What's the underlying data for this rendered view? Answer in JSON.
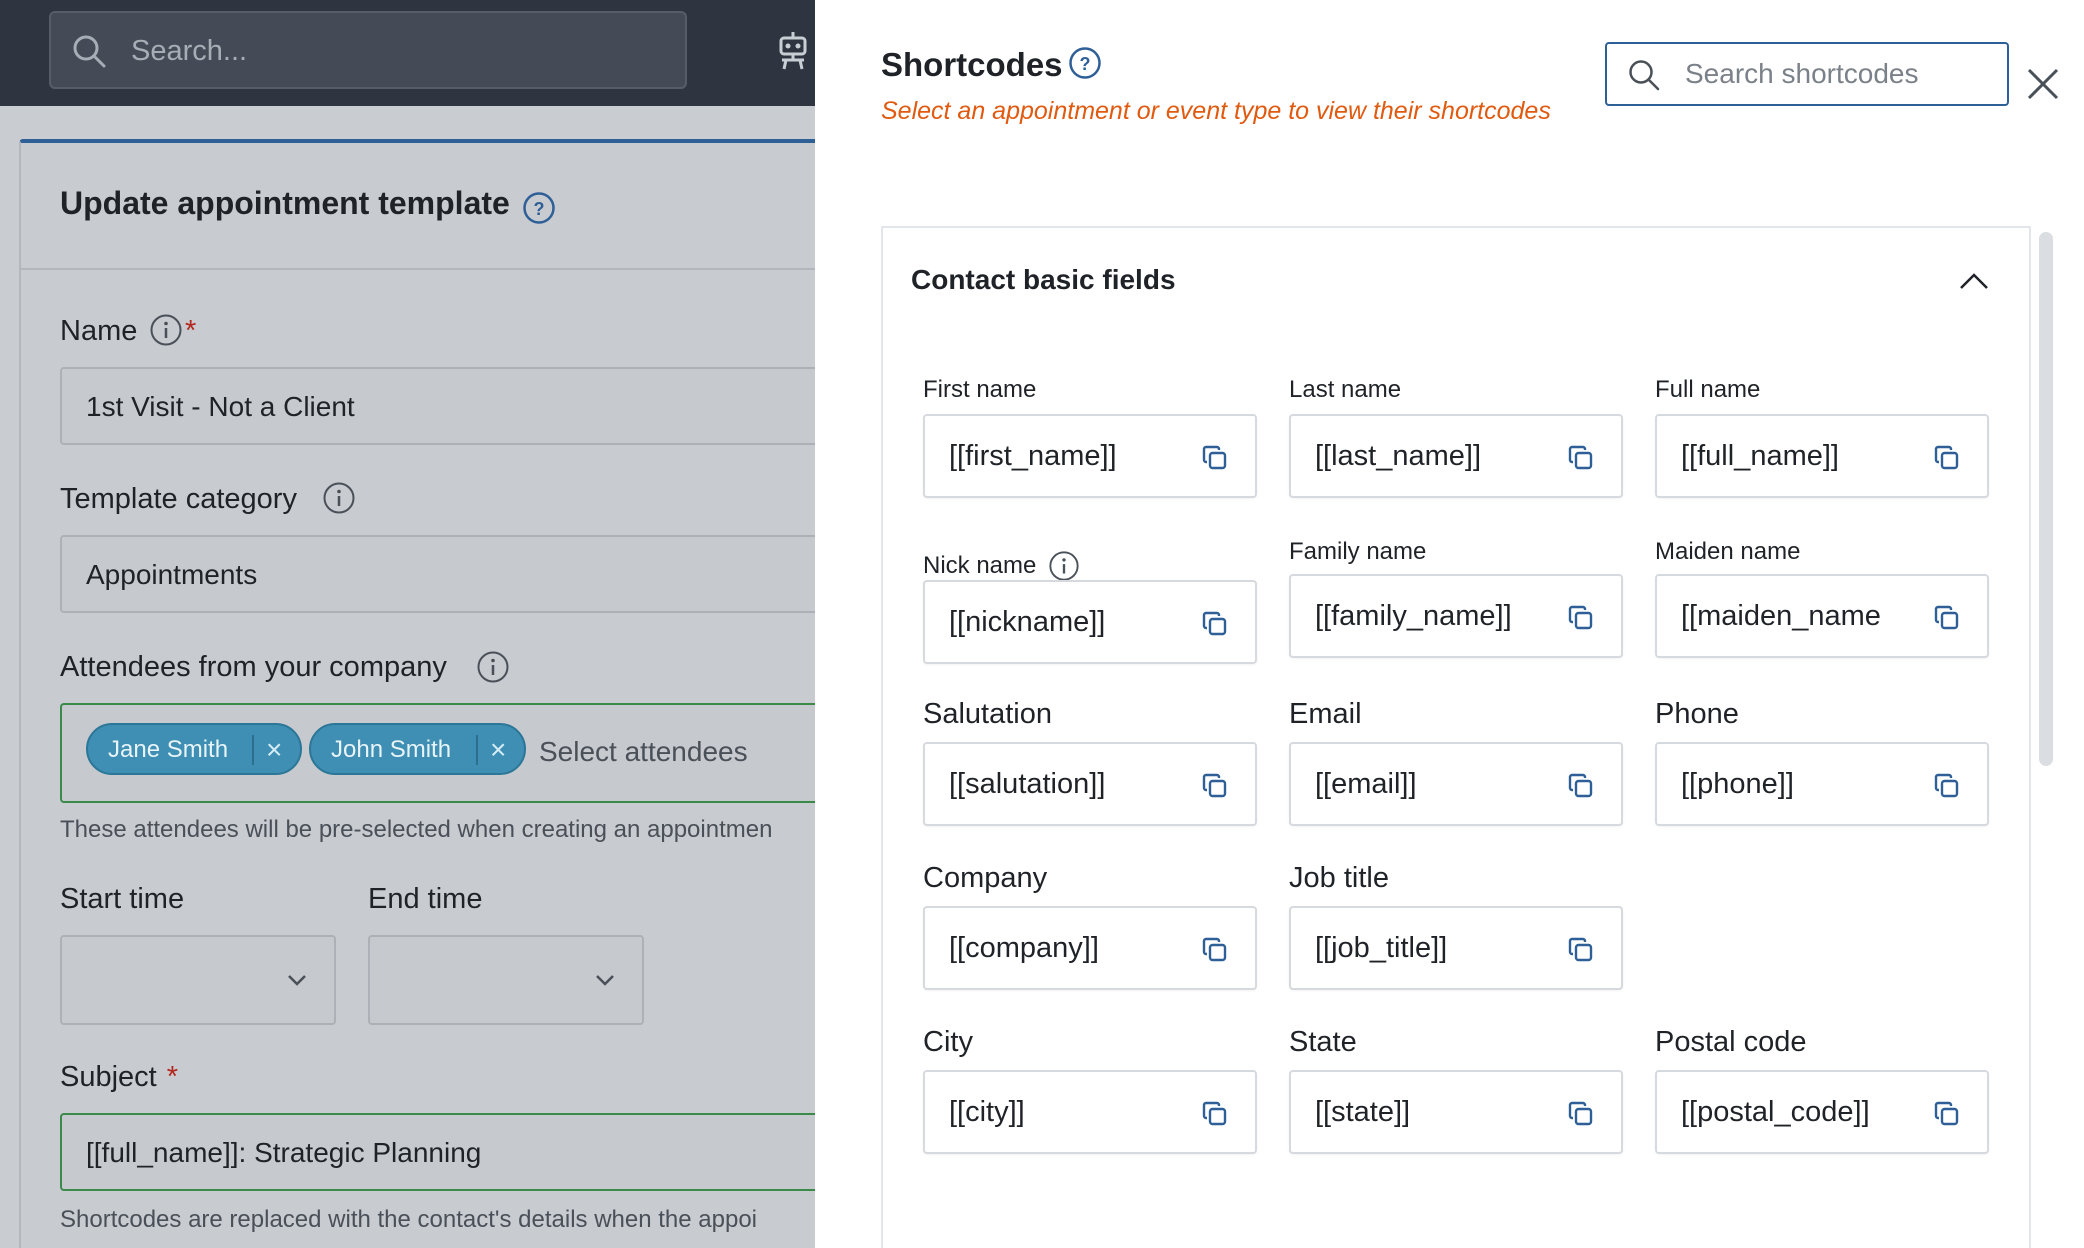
{
  "app_search": {
    "placeholder": "Search..."
  },
  "form": {
    "title": "Update appointment template",
    "name": {
      "label": "Name",
      "required_mark": "*",
      "value": "1st Visit - Not a Client"
    },
    "template_category": {
      "label": "Template category",
      "value": "Appointments"
    },
    "attendees": {
      "label": "Attendees from your company",
      "chips": [
        "Jane Smith",
        "John Smith"
      ],
      "remove_glyph": "×",
      "placeholder": "Select attendees",
      "hint": "These attendees will be pre-selected when creating an appointmen"
    },
    "start_time": {
      "label": "Start time"
    },
    "end_time": {
      "label": "End time"
    },
    "subject": {
      "label": "Subject",
      "required_mark": "*",
      "value": "[[full_name]]: Strategic Planning",
      "hint": "Shortcodes are replaced with the contact's details when the appoi"
    }
  },
  "drawer": {
    "title": "Shortcodes",
    "subtitle": "Select an appointment or event type to view their shortcodes",
    "search_placeholder": "Search shortcodes",
    "section": {
      "title": "Contact basic fields",
      "fields": [
        {
          "label": "First name",
          "code": "[[first_name]]"
        },
        {
          "label": "Last name",
          "code": "[[last_name]]"
        },
        {
          "label": "Full name",
          "code": "[[full_name]]"
        },
        {
          "label": "Nick name",
          "code": "[[nickname]]",
          "info": true
        },
        {
          "label": "Family name",
          "code": "[[family_name]]"
        },
        {
          "label": "Maiden name",
          "code": "[[maiden_name"
        },
        {
          "label": "Salutation",
          "code": "[[salutation]]"
        },
        {
          "label": "Email",
          "code": "[[email]]"
        },
        {
          "label": "Phone",
          "code": "[[phone]]"
        },
        {
          "label": "Company",
          "code": "[[company]]"
        },
        {
          "label": "Job title",
          "code": "[[job_title]]"
        },
        {
          "label": "City",
          "code": "[[city]]"
        },
        {
          "label": "State",
          "code": "[[state]]"
        },
        {
          "label": "Postal code",
          "code": "[[postal_code]]"
        }
      ]
    }
  },
  "colors": {
    "accent": "#2f5f97",
    "warning_text": "#e05a10",
    "chip": "#3e8fb3",
    "valid_border": "#3b8a4a",
    "required": "#b3261e"
  },
  "icons": [
    "search-icon",
    "robot-icon",
    "help-icon",
    "info-icon",
    "chevron-down-icon",
    "close-icon",
    "chevron-up-icon",
    "copy-icon"
  ]
}
